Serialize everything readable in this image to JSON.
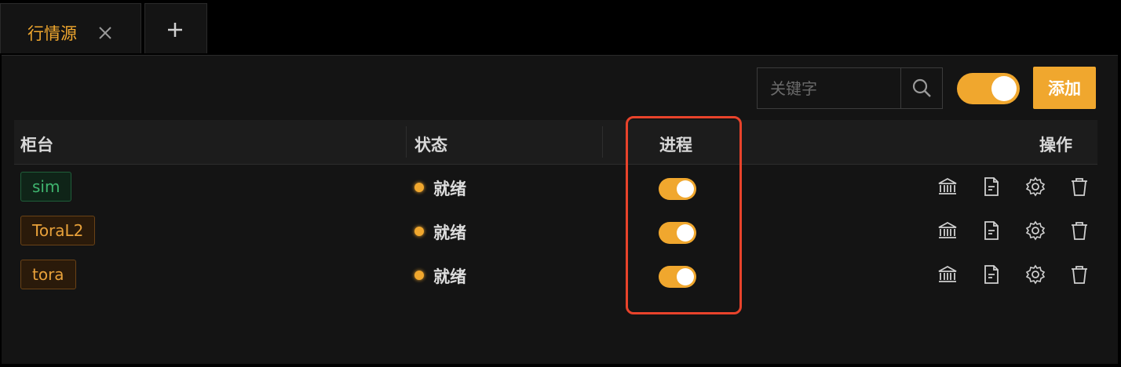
{
  "tabs": [
    {
      "label": "行情源",
      "active": true
    },
    {
      "label": "+"
    }
  ],
  "toolbar": {
    "search_placeholder": "关键字",
    "search_value": "",
    "master_toggle_on": true,
    "add_label": "添加"
  },
  "table": {
    "headers": {
      "counter": "柜台",
      "status": "状态",
      "process": "进程",
      "actions": "操作"
    },
    "rows": [
      {
        "counter": "sim",
        "counter_color": "green",
        "status": "就绪",
        "process_on": true
      },
      {
        "counter": "ToraL2",
        "counter_color": "orange",
        "status": "就绪",
        "process_on": true
      },
      {
        "counter": "tora",
        "counter_color": "orange",
        "status": "就绪",
        "process_on": true
      }
    ],
    "action_icons": [
      "bank-icon",
      "document-icon",
      "gear-icon",
      "trash-icon"
    ]
  },
  "colors": {
    "accent": "#f0a72e",
    "highlight": "#e8432b",
    "green": "#3fb56f"
  }
}
